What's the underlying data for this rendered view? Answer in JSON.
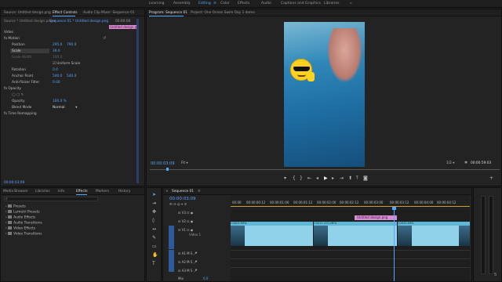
{
  "workspaces": [
    "Learning",
    "Assembly",
    "Editing",
    "Color",
    "Effects",
    "Audio",
    "Captions and Graphics",
    "Libraries"
  ],
  "active_workspace": "Editing",
  "effect_controls": {
    "tabs": [
      "Source: Untitled design.png",
      "Effect Controls",
      "Audio Clip Mixer: Sequence 01"
    ],
    "sequence_label": "Sequence 01 * Untitled design.png",
    "mini_clip_label": "Untitled design.png",
    "mini_time": "00:00:00",
    "section_video": "Video",
    "motion": "Motion",
    "position": {
      "label": "Position",
      "x": "295.0",
      "y": "790.0"
    },
    "scale": {
      "label": "Scale",
      "value": "39.0"
    },
    "scale_width": {
      "label": "Scale Width",
      "value": "100.0"
    },
    "uniform_scale": "Uniform Scale",
    "rotation": {
      "label": "Rotation",
      "value": "0.0"
    },
    "anchor": {
      "label": "Anchor Point",
      "x": "540.0",
      "y": "540.0"
    },
    "anti_flicker": {
      "label": "Anti-flicker Filter",
      "value": "0.00"
    },
    "opacity": "Opacity",
    "opacity_val": {
      "label": "Opacity",
      "value": "100.0 %"
    },
    "blend": {
      "label": "Blend Mode",
      "value": "Normal"
    },
    "time_remap": "Time Remapping",
    "timecode": "00:00:03:09"
  },
  "program": {
    "tabs": [
      "Program: Sequence 01",
      "Project: One Ocean Swim Day 1 demo"
    ],
    "timecode": "00:00:03:09",
    "fit": "Fit",
    "ratio": "1/2",
    "duration": "00:00:59:03"
  },
  "effects_panel": {
    "tabs": [
      "Media Browser",
      "Libraries",
      "Info",
      "Effects",
      "Markers",
      "History"
    ],
    "items": [
      "Presets",
      "Lumetri Presets",
      "Audio Effects",
      "Audio Transitions",
      "Video Effects",
      "Video Transitions"
    ]
  },
  "timeline": {
    "tab": "Sequence 01",
    "timecode": "00:00:03:09",
    "ruler": [
      "00:00",
      "00:00:00:12",
      "00:00:01:00",
      "00:00:01:12",
      "00:00:02:00",
      "00:00:02:12",
      "00:00:03:00",
      "00:00:03:12",
      "00:00:04:00",
      "00:00:04:12"
    ],
    "graphic_clip": "Untitled design.png",
    "video_clips": [
      "C0003.MP4",
      "C0012 (37).MP4",
      "C0035.MP4"
    ],
    "tracks": [
      "V3",
      "V2",
      "V1",
      "A1",
      "A2",
      "A3"
    ],
    "track_name_v1": "Video 1",
    "mix": "Mix",
    "mix_val": "0.0"
  },
  "colors": {
    "accent": "#5aa2ff",
    "pink": "#d98bd3",
    "clip": "#8fd2ea",
    "audio": "#3f8f6b"
  }
}
